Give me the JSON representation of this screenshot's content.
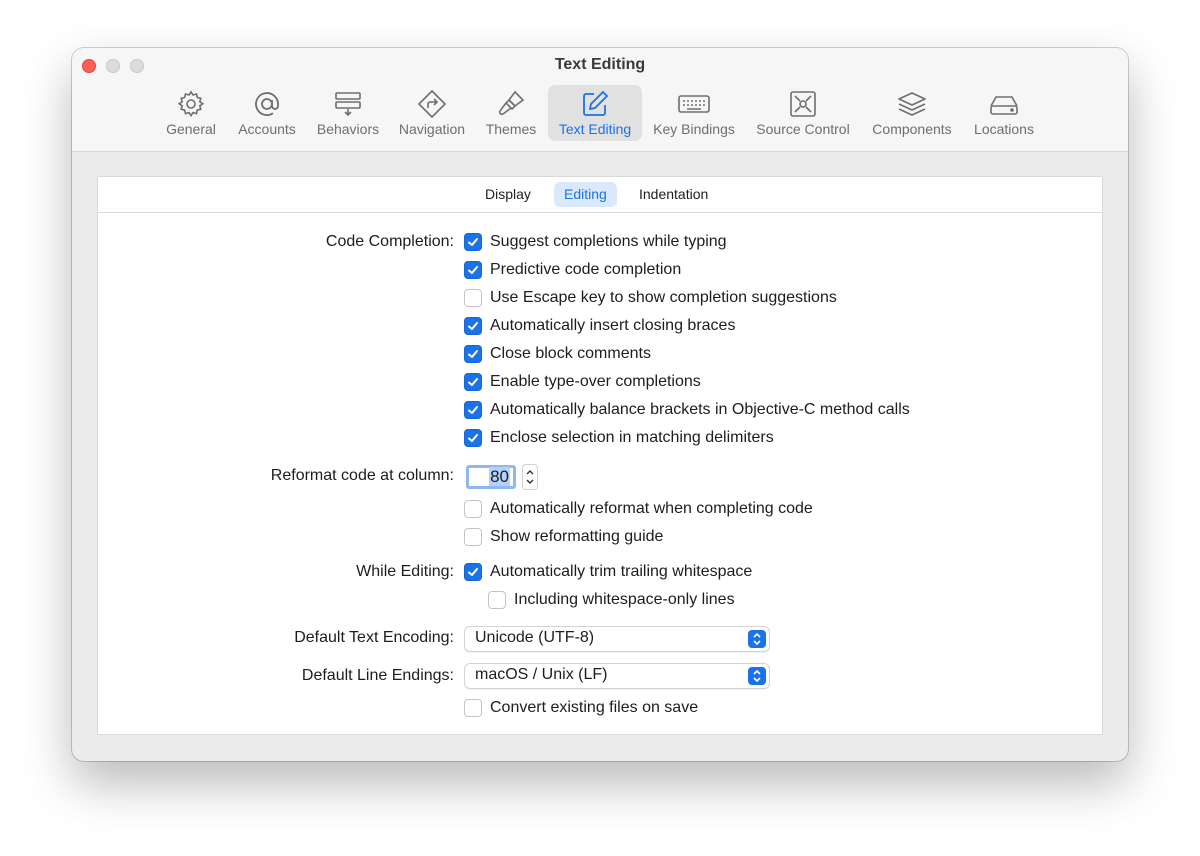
{
  "window": {
    "title": "Text Editing"
  },
  "toolbar": {
    "items": [
      {
        "label": "General",
        "icon": "gear-icon"
      },
      {
        "label": "Accounts",
        "icon": "at-icon"
      },
      {
        "label": "Behaviors",
        "icon": "behaviors-icon"
      },
      {
        "label": "Navigation",
        "icon": "navigation-icon"
      },
      {
        "label": "Themes",
        "icon": "paintbrush-icon"
      },
      {
        "label": "Text Editing",
        "icon": "pencil-square-icon",
        "selected": true
      },
      {
        "label": "Key Bindings",
        "icon": "keyboard-icon"
      },
      {
        "label": "Source Control",
        "icon": "source-control-icon"
      },
      {
        "label": "Components",
        "icon": "layers-icon"
      },
      {
        "label": "Locations",
        "icon": "drive-icon"
      }
    ]
  },
  "tabs": [
    {
      "label": "Display"
    },
    {
      "label": "Editing",
      "selected": true
    },
    {
      "label": "Indentation"
    }
  ],
  "code_completion": {
    "label": "Code Completion:",
    "options": [
      {
        "label": "Suggest completions while typing",
        "checked": true
      },
      {
        "label": "Predictive code completion",
        "checked": true
      },
      {
        "label": "Use Escape key to show completion suggestions",
        "checked": false
      },
      {
        "label": "Automatically insert closing braces",
        "checked": true
      },
      {
        "label": "Close block comments",
        "checked": true
      },
      {
        "label": "Enable type-over completions",
        "checked": true
      },
      {
        "label": "Automatically balance brackets in Objective-C method calls",
        "checked": true
      },
      {
        "label": "Enclose selection in matching delimiters",
        "checked": true
      }
    ]
  },
  "reformat": {
    "label": "Reformat code at column:",
    "column": "80",
    "options": [
      {
        "label": "Automatically reformat when completing code",
        "checked": false
      },
      {
        "label": "Show reformatting guide",
        "checked": false
      }
    ]
  },
  "while_editing": {
    "label": "While Editing:",
    "trim": {
      "label": "Automatically trim trailing whitespace",
      "checked": true
    },
    "whitespace_only": {
      "label": "Including whitespace-only lines",
      "checked": false
    }
  },
  "encoding": {
    "label": "Default Text Encoding:",
    "value": "Unicode (UTF-8)"
  },
  "line_endings": {
    "label": "Default Line Endings:",
    "value": "macOS / Unix (LF)",
    "convert": {
      "label": "Convert existing files on save",
      "checked": false
    }
  },
  "colors": {
    "accent": "#1a73e8",
    "close_light": "#ff5f57"
  }
}
